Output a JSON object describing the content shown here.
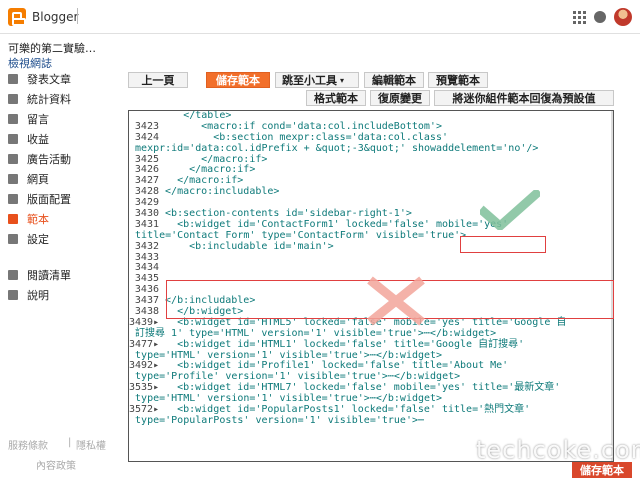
{
  "header": {
    "app_name": "Blogger"
  },
  "sidebar": {
    "blog_name": "可樂的第二實驗…",
    "view_blog": "檢視網誌",
    "items": [
      {
        "label": "發表文章",
        "icon": "posts-icon"
      },
      {
        "label": "統計資料",
        "icon": "stats-icon"
      },
      {
        "label": "留言",
        "icon": "comments-icon"
      },
      {
        "label": "收益",
        "icon": "earnings-icon"
      },
      {
        "label": "廣告活動",
        "icon": "campaigns-icon"
      },
      {
        "label": "網頁",
        "icon": "pages-icon"
      },
      {
        "label": "版面配置",
        "icon": "layout-icon"
      },
      {
        "label": "範本",
        "icon": "theme-icon",
        "active": true
      },
      {
        "label": "設定",
        "icon": "settings-icon"
      }
    ],
    "items2": [
      {
        "label": "閱讀清單",
        "icon": "reading-list-icon"
      },
      {
        "label": "說明",
        "icon": "help-icon"
      }
    ],
    "footer": {
      "terms": "服務條款",
      "privacy": "隱私權",
      "content_policy": "內容政策"
    }
  },
  "toolbar": {
    "back": "上一頁",
    "save": "儲存範本",
    "jump": "跳至小工具",
    "edit": "編輯範本",
    "preview": "預覽範本",
    "format": "格式範本",
    "revert": "復原變更",
    "reset_widgets": "將迷你組件範本回復為預設值"
  },
  "editor": {
    "lines": [
      {
        "n": "",
        "t": "        </table>"
      },
      {
        "n": "3423",
        "t": "      <macro:if cond='data:col.includeBottom'>"
      },
      {
        "n": "3424",
        "t": "        <b:section mexpr:class='data:col.class'"
      },
      {
        "n": "",
        "t": "mexpr:id='data:col.idPrefix + &quot;-3&quot;' showaddelement='no'/>"
      },
      {
        "n": "3425",
        "t": "      </macro:if>"
      },
      {
        "n": "3426",
        "t": "    </macro:if>"
      },
      {
        "n": "3427",
        "t": "  </macro:if>"
      },
      {
        "n": "3428",
        "t": "</macro:includable>"
      },
      {
        "n": "3429",
        "t": ""
      },
      {
        "n": "3430",
        "t": "<b:section-contents id='sidebar-right-1'>"
      },
      {
        "n": "3431",
        "t": "  <b:widget id='ContactForm1' locked='false' mobile='yes'"
      },
      {
        "n": "",
        "t": "title='Contact Form' type='ContactForm' visible='true'>"
      },
      {
        "n": "3432",
        "t": "    <b:includable id='main'>"
      },
      {
        "n": "3433",
        "t": ""
      },
      {
        "n": "3434",
        "t": ""
      },
      {
        "n": "3435",
        "t": ""
      },
      {
        "n": "3436",
        "t": ""
      },
      {
        "n": "3437",
        "t": "</b:includable>"
      },
      {
        "n": "3438",
        "t": "  </b:widget>"
      },
      {
        "n": "3439▸",
        "t": "  <b:widget id='HTML5' locked='false' mobile='yes' title='Google 自"
      },
      {
        "n": "",
        "t": "訂搜尋 1' type='HTML' version='1' visible='true'>⋯</b:widget>"
      },
      {
        "n": "3477▸",
        "t": "  <b:widget id='HTML1' locked='false' title='Google 自訂搜尋'"
      },
      {
        "n": "",
        "t": "type='HTML' version='1' visible='true'>⋯</b:widget>"
      },
      {
        "n": "3492▸",
        "t": "  <b:widget id='Profile1' locked='false' title='About Me'"
      },
      {
        "n": "",
        "t": "type='Profile' version='1' visible='true'>⋯</b:widget>"
      },
      {
        "n": "3535▸",
        "t": "  <b:widget id='HTML7' locked='false' mobile='yes' title='最新文章'"
      },
      {
        "n": "",
        "t": "type='HTML' version='1' visible='true'>⋯</b:widget>"
      },
      {
        "n": "3572▸",
        "t": "  <b:widget id='PopularPosts1' locked='false' title='熱門文章'"
      },
      {
        "n": "",
        "t": "type='PopularPosts' version='1' visible='true'>⋯"
      }
    ]
  },
  "watermark": "techcoke.com",
  "save_badge": "儲存範本",
  "colors": {
    "accent": "#f26f2a",
    "highlight": "#e04040",
    "check": "#7fbf9a",
    "cross": "#f2a49a",
    "code": "#0e7a7a"
  }
}
